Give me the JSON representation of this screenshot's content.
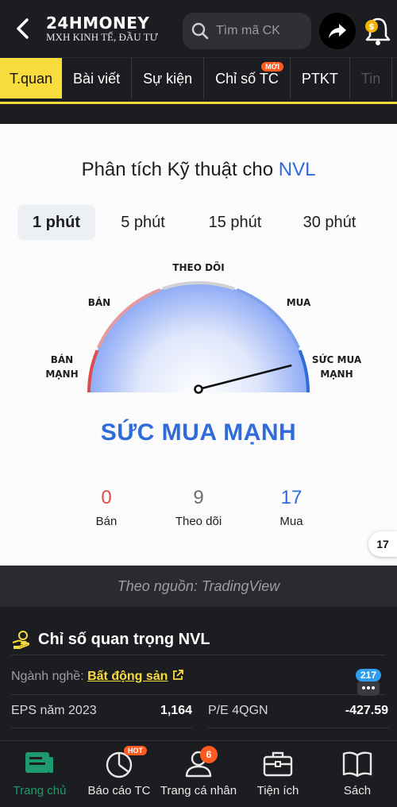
{
  "header": {
    "brand_name": "24HMONEY",
    "brand_tagline": "MXH KINH TẾ, ĐẦU TƯ",
    "search_placeholder": "Tìm mã CK",
    "icons": [
      "back-icon",
      "search-icon",
      "share-icon",
      "bell-icon",
      "coin-icon"
    ]
  },
  "tabs": [
    {
      "label": "T.quan",
      "active": true
    },
    {
      "label": "Bài viết"
    },
    {
      "label": "Sự kiện"
    },
    {
      "label": "Chỉ số TC",
      "badge": "MỚI"
    },
    {
      "label": "PTKT"
    },
    {
      "label": "Tin"
    }
  ],
  "analysis": {
    "title": "Phân tích Kỹ thuật cho",
    "symbol": "NVL",
    "intervals": [
      "1 phút",
      "5 phút",
      "15 phút",
      "30 phút"
    ],
    "active_interval": "1 phút",
    "gauge": {
      "labels": {
        "strong_sell": "BÁN MẠNH",
        "sell": "BÁN",
        "neutral": "THEO DÕI",
        "buy": "MUA",
        "strong_buy": "SỨC MUA MẠNH"
      },
      "needle_fraction": 0.92
    },
    "verdict": "SỨC MUA MẠNH",
    "counts": {
      "sell": {
        "value": "0",
        "label": "Bán",
        "color": "#e14b4b"
      },
      "neutral": {
        "value": "9",
        "label": "Theo dõi",
        "color": "#6b6d72"
      },
      "buy": {
        "value": "17",
        "label": "Mua",
        "color": "#2f6bd9"
      }
    },
    "tv_logo": "17"
  },
  "source": "Theo nguồn: TradingView",
  "key_indicators": {
    "title": "Chỉ số quan trọng NVL",
    "industry_label": "Ngành nghề:",
    "industry_value": "Bất động sản",
    "comment_count": "217",
    "metrics": [
      {
        "label": "EPS năm 2023",
        "value": "1,164"
      },
      {
        "label": "P/E 4QGN",
        "value": "-427.59"
      }
    ]
  },
  "bottom_nav": [
    {
      "label": "Trang chủ",
      "icon": "home-icon",
      "active": true
    },
    {
      "label": "Báo cáo TC",
      "icon": "report-icon",
      "badge": "HOT"
    },
    {
      "label": "Trang cá nhân",
      "icon": "profile-icon",
      "badge": "6"
    },
    {
      "label": "Tiện ích",
      "icon": "briefcase-icon"
    },
    {
      "label": "Sách",
      "icon": "book-icon"
    }
  ],
  "colors": {
    "accent_yellow": "#f7dc3b",
    "buy_blue": "#2f6bd9",
    "sell_red": "#e14b4b",
    "active_green": "#1f9a6e"
  }
}
